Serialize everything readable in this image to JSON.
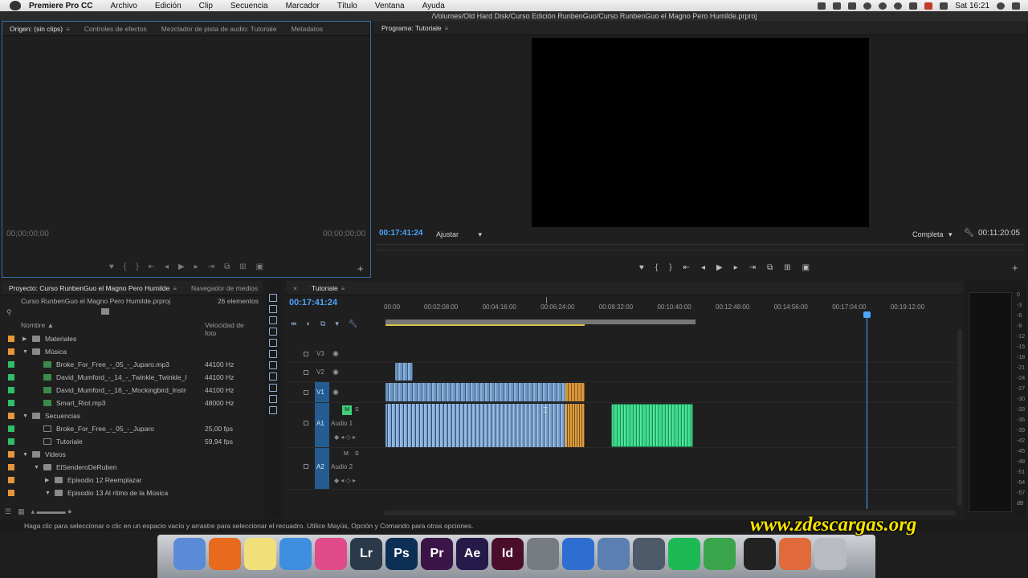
{
  "menubar": {
    "app": "Premiere Pro CC",
    "items": [
      "Archivo",
      "Edición",
      "Clip",
      "Secuencia",
      "Marcador",
      "Título",
      "Ventana",
      "Ayuda"
    ],
    "clock": "Sat 16:21"
  },
  "window": {
    "path": "/Volumes/Old Hard Disk/Curso Edición RunbenGuo/Curso RunbenGuo el Magno Pero Humilde.prproj"
  },
  "source": {
    "tabs": [
      "Origen: (sin clips)",
      "Controles de efectos",
      "Mezclador de pista de audio: Tutoriale",
      "Metadatos"
    ],
    "timecode_in": "00;00;00;00",
    "timecode_out": "00;00;00;00"
  },
  "program": {
    "tab": "Programa: Tutoriale",
    "timecode": "00:17:41:24",
    "fit": "Ajustar",
    "quality": "Completa",
    "duration": "00:11:20:05"
  },
  "project": {
    "tabs": [
      "Proyecto: Curso RunbenGuo el Magno Pero Humilde",
      "Navegador de medios"
    ],
    "file": "Curso RunbenGuo el Magno Pero Humilde.prproj",
    "count": "26 elementos",
    "col_name": "Nombre",
    "col_rate": "Velocidad de foto",
    "items": [
      {
        "name": "Materiales",
        "rate": "",
        "color": "#e8963a",
        "indent": 0,
        "kind": "folder",
        "tri": "▶"
      },
      {
        "name": "Música",
        "rate": "",
        "color": "#e8963a",
        "indent": 0,
        "kind": "folder",
        "tri": "▼"
      },
      {
        "name": "Broke_For_Free_-_05_-_Juparo.mp3",
        "rate": "44100 Hz",
        "color": "#2fbf6a",
        "indent": 1,
        "kind": "audio",
        "tri": ""
      },
      {
        "name": "David_Mumford_-_14_-_Twinkle_Twinkle_Instru",
        "rate": "44100 Hz",
        "color": "#2fbf6a",
        "indent": 1,
        "kind": "audio",
        "tri": ""
      },
      {
        "name": "David_Mumford_-_16_-_Mockingbird_Instrument",
        "rate": "44100 Hz",
        "color": "#2fbf6a",
        "indent": 1,
        "kind": "audio",
        "tri": ""
      },
      {
        "name": "Smart_Riot.mp3",
        "rate": "48000 Hz",
        "color": "#2fbf6a",
        "indent": 1,
        "kind": "audio",
        "tri": ""
      },
      {
        "name": "Secuencias",
        "rate": "",
        "color": "#e8963a",
        "indent": 0,
        "kind": "folder",
        "tri": "▼"
      },
      {
        "name": "Broke_For_Free_-_05_-_Juparo",
        "rate": "25,00 fps",
        "color": "#2fbf6a",
        "indent": 1,
        "kind": "seq",
        "tri": ""
      },
      {
        "name": "Tutoriale",
        "rate": "59,94 fps",
        "color": "#2fbf6a",
        "indent": 1,
        "kind": "seq",
        "tri": ""
      },
      {
        "name": "Videos",
        "rate": "",
        "color": "#e8963a",
        "indent": 0,
        "kind": "folder",
        "tri": "▼"
      },
      {
        "name": "ElSenderoDeRuben",
        "rate": "",
        "color": "#e8963a",
        "indent": 1,
        "kind": "folder",
        "tri": "▼"
      },
      {
        "name": "Episodio 12 Reemplazar",
        "rate": "",
        "color": "#e8963a",
        "indent": 2,
        "kind": "folder",
        "tri": "▶"
      },
      {
        "name": "Episodio 13 Al ritmo de la Música",
        "rate": "",
        "color": "#e8963a",
        "indent": 2,
        "kind": "folder",
        "tri": "▼"
      }
    ]
  },
  "timeline": {
    "tab": "Tutoriale",
    "timecode": "00:17:41:24",
    "ruler": [
      "00:00",
      "00:02:08:00",
      "00:04:16:00",
      "00:06:24:00",
      "00:08:32:00",
      "00:10:40:00",
      "00:12:48:00",
      "00:14:56:00",
      "00:17:04:00",
      "00:19:12:00"
    ],
    "tracks": [
      {
        "label": "V3",
        "name": ""
      },
      {
        "label": "V2",
        "name": ""
      },
      {
        "label": "V1",
        "name": ""
      },
      {
        "label": "A1",
        "name": "Audio 1",
        "m": "M",
        "s": "S"
      },
      {
        "label": "A2",
        "name": "Audio 2",
        "m": "M",
        "s": "S"
      }
    ]
  },
  "meter": {
    "labels": [
      "0",
      "-3",
      "-6",
      "-9",
      "-12",
      "-15",
      "-18",
      "-21",
      "-24",
      "-27",
      "-30",
      "-33",
      "-36",
      "-39",
      "-42",
      "-45",
      "-48",
      "-51",
      "-54",
      "-57",
      "dB"
    ]
  },
  "status": "Haga clic para seleccionar o clic en un espacio vacío y arrastre para seleccionar el recuadro. Utilice Mayús, Opción y Comando para otras opciones.",
  "dock": {
    "apps": [
      {
        "label": "",
        "color": "#5b8bd6"
      },
      {
        "label": "",
        "color": "#e86a1c"
      },
      {
        "label": "",
        "color": "#f1e07a"
      },
      {
        "label": "",
        "color": "#3f8fe0"
      },
      {
        "label": "",
        "color": "#e24b8a"
      },
      {
        "label": "Lr",
        "color": "#2b3a4a"
      },
      {
        "label": "Ps",
        "color": "#0d2f55"
      },
      {
        "label": "Pr",
        "color": "#3b1548"
      },
      {
        "label": "Ae",
        "color": "#251a4a"
      },
      {
        "label": "Id",
        "color": "#4a0d2a"
      },
      {
        "label": "",
        "color": "#777b82"
      },
      {
        "label": "",
        "color": "#2f6ed1"
      },
      {
        "label": "",
        "color": "#5a7fb0"
      },
      {
        "label": "",
        "color": "#4d5a6a"
      },
      {
        "label": "",
        "color": "#1db954"
      },
      {
        "label": "",
        "color": "#3aa54a"
      },
      {
        "label": "",
        "color": "#222222"
      },
      {
        "label": "",
        "color": "#e06a3a"
      },
      {
        "label": "",
        "color": "#b8bcc2"
      }
    ]
  },
  "watermark": "www.zdescargas.org"
}
